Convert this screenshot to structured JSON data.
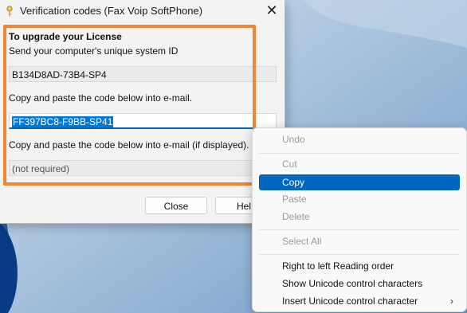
{
  "window": {
    "title": "Verification codes (Fax Voip SoftPhone)",
    "close_glyph": "✕"
  },
  "license": {
    "heading": "To upgrade your License",
    "subtext": "Send your computer's unique system ID",
    "system_id": "B134D8AD-73B4-SP4",
    "instruction1": "Copy and paste the code below into e-mail.",
    "code": "FF397BC8-F9BB-SP41",
    "instruction2": "Copy and paste the code below into e-mail (if displayed).",
    "not_required": "(not required)"
  },
  "buttons": {
    "close": "Close",
    "help_partial": "Hel"
  },
  "context_menu": {
    "items": [
      {
        "label": "Undo",
        "enabled": false
      },
      {
        "label": "Cut",
        "enabled": false
      },
      {
        "label": "Copy",
        "enabled": true,
        "highlighted": true
      },
      {
        "label": "Paste",
        "enabled": false
      },
      {
        "label": "Delete",
        "enabled": false
      },
      {
        "label": "Select All",
        "enabled": false
      },
      {
        "label": "Right to left Reading order",
        "enabled": true
      },
      {
        "label": "Show Unicode control characters",
        "enabled": true
      },
      {
        "label": "Insert Unicode control character",
        "enabled": true,
        "submenu": true
      }
    ],
    "submenu_glyph": "›"
  },
  "colors": {
    "highlight_frame": "#f08732",
    "selection": "#0078d7",
    "menu_highlight": "#0067c0"
  },
  "icons": {
    "title": "key-icon",
    "close": "close-icon",
    "submenu": "chevron-right-icon"
  }
}
